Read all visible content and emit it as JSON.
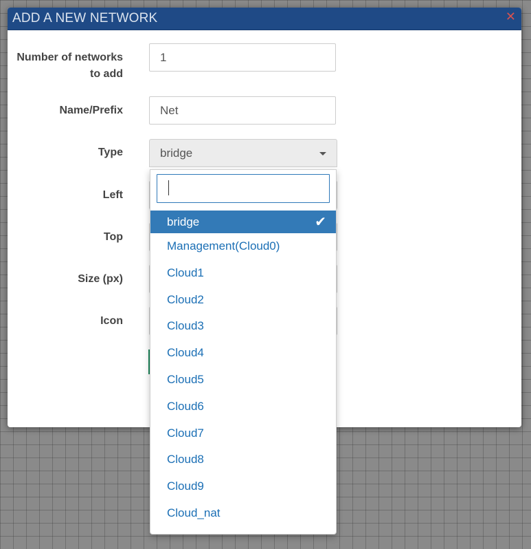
{
  "dialog": {
    "title": "ADD A NEW NETWORK",
    "close_icon": "close-icon"
  },
  "form": {
    "count_label": "Number of networks to add",
    "count_value": "1",
    "name_label": "Name/Prefix",
    "name_value": "Net",
    "type_label": "Type",
    "type_value": "bridge",
    "left_label": "Left",
    "top_label": "Top",
    "size_label": "Size (px)",
    "icon_label": "Icon"
  },
  "dropdown": {
    "search_value": "",
    "selected": "bridge",
    "options": [
      "bridge",
      "Management(Cloud0)",
      "Cloud1",
      "Cloud2",
      "Cloud3",
      "Cloud4",
      "Cloud5",
      "Cloud6",
      "Cloud7",
      "Cloud8",
      "Cloud9",
      "Cloud_nat"
    ]
  },
  "colors": {
    "header": "#1f4a86",
    "selected_option": "#337ab7",
    "option_text": "#1b6fb5",
    "close": "#d9534f"
  }
}
